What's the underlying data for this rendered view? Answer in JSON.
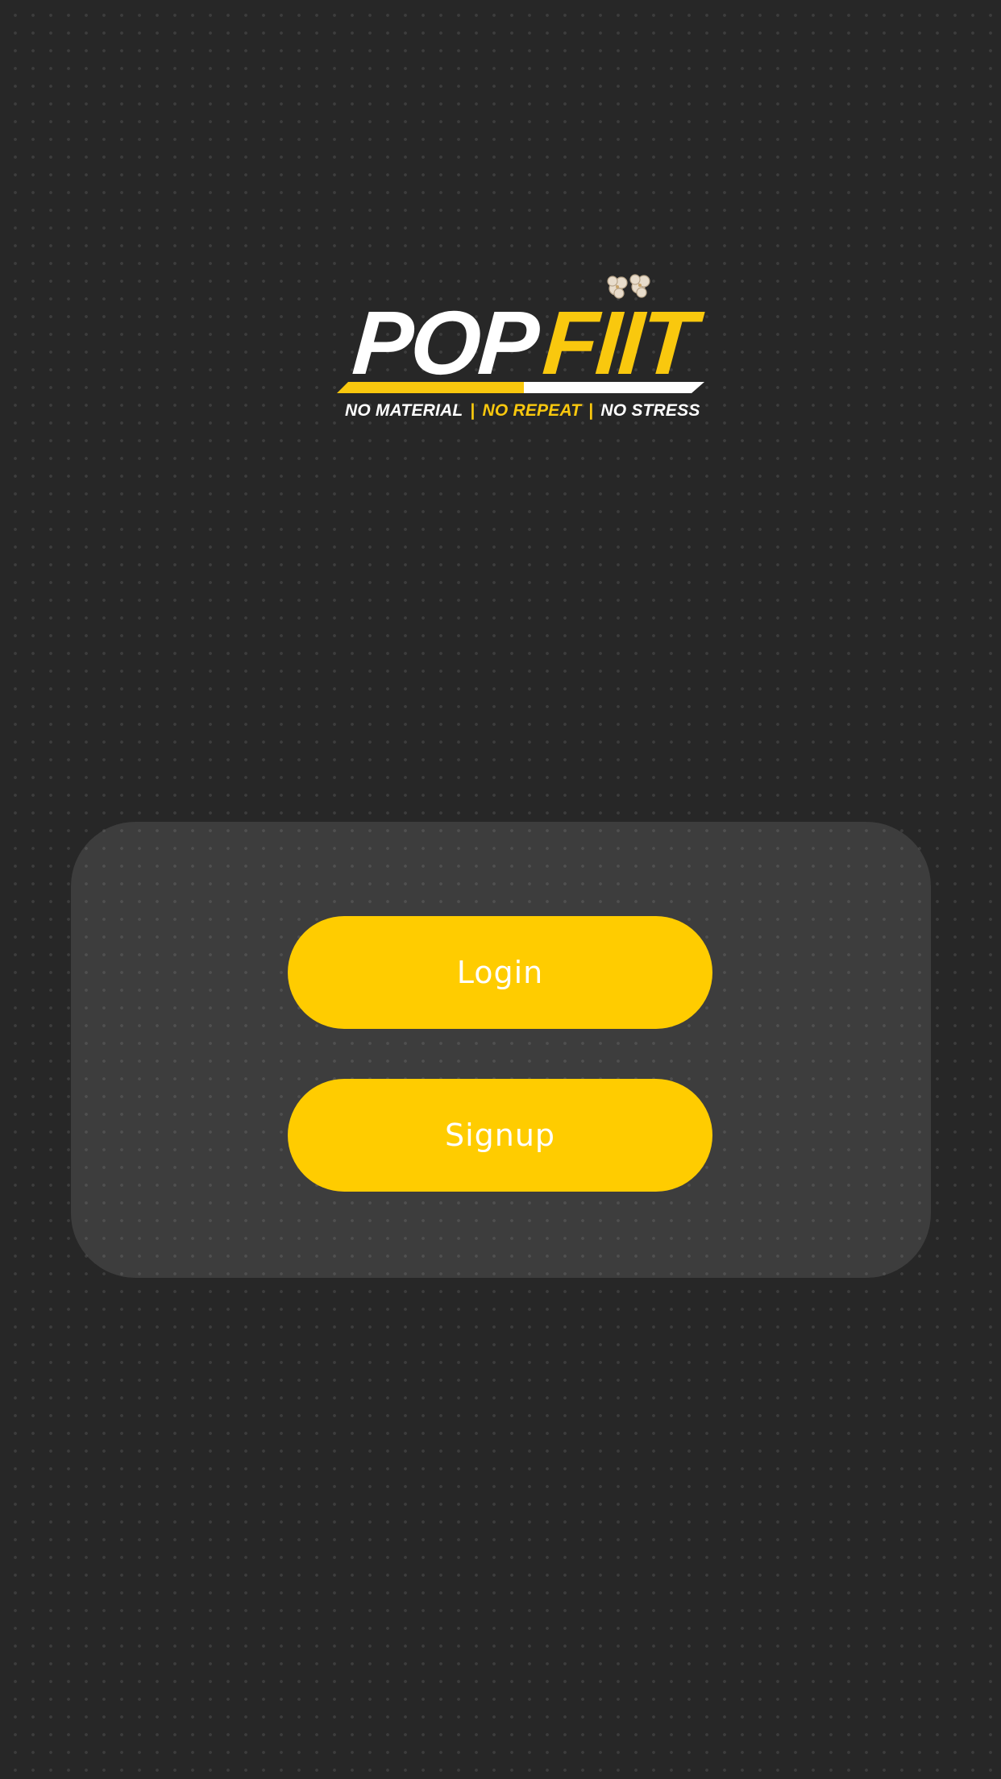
{
  "logo": {
    "word_white": "POP",
    "word_yellow": "FIIT",
    "tagline": {
      "part1": "NO MATERIAL",
      "separator": "|",
      "part2": "NO REPEAT",
      "part3": "NO STRESS"
    }
  },
  "buttons": {
    "login_label": "Login",
    "signup_label": "Signup"
  },
  "colors": {
    "background": "#272727",
    "accent": "#ffcc00",
    "logo_yellow": "#f9c80e",
    "panel": "rgba(255,255,255,0.10)",
    "button_text": "#ffffff"
  },
  "icons": {
    "logo_decoration": "popcorn-icon"
  }
}
